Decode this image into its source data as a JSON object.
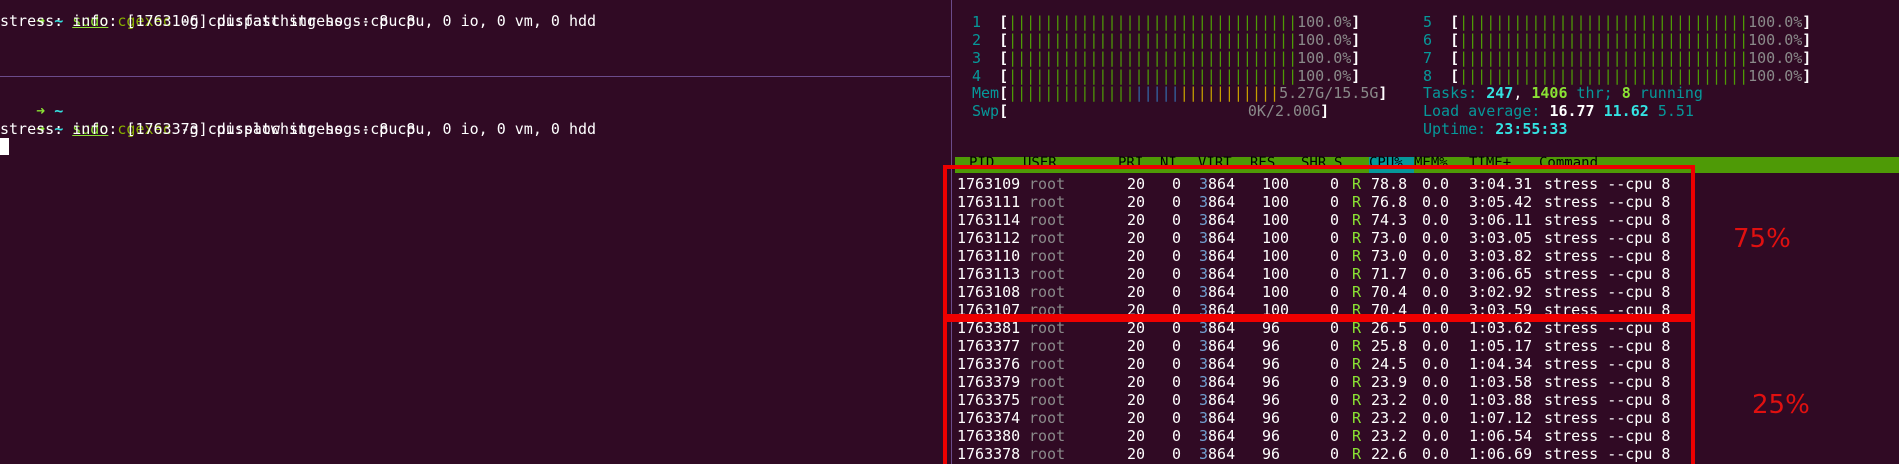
{
  "terminal_left_top": {
    "prompt_arrow": "➜",
    "prompt_tilde": "~",
    "cmd_sudo": "sudo",
    "cmd_cgexec": "cgexec",
    "cmd_rest": "-g cpu:fast stress --cpu 8",
    "output": "stress: info: [1763106] dispatching hogs: 8 cpu, 0 io, 0 vm, 0 hdd"
  },
  "terminal_left_bottom": {
    "prompt1_arrow": "➜",
    "prompt1_tilde": "~",
    "prompt2_arrow": "➜",
    "prompt2_tilde": "~",
    "cmd_sudo": "sudo",
    "cmd_cgexec": "cgexec",
    "cmd_rest": "-g cpu:slow stress --cpu 8",
    "output": "stress: info: [1763373] dispatching hogs: 8 cpu, 0 io, 0 vm, 0 hdd"
  },
  "htop": {
    "cpus": [
      {
        "id": "1",
        "bar": "||||||||||||||||||||||||||||||||",
        "pct": "100.0%"
      },
      {
        "id": "2",
        "bar": "||||||||||||||||||||||||||||||||",
        "pct": "100.0%"
      },
      {
        "id": "3",
        "bar": "||||||||||||||||||||||||||||||||",
        "pct": "100.0%"
      },
      {
        "id": "4",
        "bar": "||||||||||||||||||||||||||||||||",
        "pct": "100.0%"
      },
      {
        "id": "5",
        "bar": "||||||||||||||||||||||||||||||||",
        "pct": "100.0%"
      },
      {
        "id": "6",
        "bar": "||||||||||||||||||||||||||||||||",
        "pct": "100.0%"
      },
      {
        "id": "7",
        "bar": "||||||||||||||||||||||||||||||||",
        "pct": "100.0%"
      },
      {
        "id": "8",
        "bar": "||||||||||||||||||||||||||||||||",
        "pct": "100.0%"
      }
    ],
    "mem_label": "Mem",
    "mem_bar_green": "||||||||||||||",
    "mem_bar_blue": "|||||",
    "mem_bar_yellow": "|||||||||||",
    "mem_value": "5.27G/15.5G",
    "swp_label": "Swp",
    "swp_value": "0K/2.00G",
    "tasks_label": "Tasks:",
    "tasks_count": "247",
    "tasks_thr": "1406",
    "tasks_thr_label": "thr;",
    "tasks_running": "8",
    "tasks_running_label": "running",
    "load_label": "Load average:",
    "load_1": "16.77",
    "load_5": "11.62",
    "load_15": "5.51",
    "uptime_label": "Uptime:",
    "uptime_value": "23:55:33",
    "columns": [
      "PID",
      "USER",
      "PRI",
      "NI",
      "VIRT",
      "RES",
      "SHR",
      "S",
      "CPU%",
      "MEM%",
      "TIME+",
      "Command"
    ],
    "processes": [
      {
        "pid": "1763109",
        "user": "root",
        "pri": "20",
        "ni": "0",
        "virt": "3864",
        "res": "100",
        "shr": "0",
        "s": "R",
        "cpu": "78.8",
        "mem": "0.0",
        "time": "3:04.31",
        "cmd": "stress --cpu 8"
      },
      {
        "pid": "1763111",
        "user": "root",
        "pri": "20",
        "ni": "0",
        "virt": "3864",
        "res": "100",
        "shr": "0",
        "s": "R",
        "cpu": "76.8",
        "mem": "0.0",
        "time": "3:05.42",
        "cmd": "stress --cpu 8"
      },
      {
        "pid": "1763114",
        "user": "root",
        "pri": "20",
        "ni": "0",
        "virt": "3864",
        "res": "100",
        "shr": "0",
        "s": "R",
        "cpu": "74.3",
        "mem": "0.0",
        "time": "3:06.11",
        "cmd": "stress --cpu 8"
      },
      {
        "pid": "1763112",
        "user": "root",
        "pri": "20",
        "ni": "0",
        "virt": "3864",
        "res": "100",
        "shr": "0",
        "s": "R",
        "cpu": "73.0",
        "mem": "0.0",
        "time": "3:03.05",
        "cmd": "stress --cpu 8"
      },
      {
        "pid": "1763110",
        "user": "root",
        "pri": "20",
        "ni": "0",
        "virt": "3864",
        "res": "100",
        "shr": "0",
        "s": "R",
        "cpu": "73.0",
        "mem": "0.0",
        "time": "3:03.82",
        "cmd": "stress --cpu 8"
      },
      {
        "pid": "1763113",
        "user": "root",
        "pri": "20",
        "ni": "0",
        "virt": "3864",
        "res": "100",
        "shr": "0",
        "s": "R",
        "cpu": "71.7",
        "mem": "0.0",
        "time": "3:06.65",
        "cmd": "stress --cpu 8"
      },
      {
        "pid": "1763108",
        "user": "root",
        "pri": "20",
        "ni": "0",
        "virt": "3864",
        "res": "100",
        "shr": "0",
        "s": "R",
        "cpu": "70.4",
        "mem": "0.0",
        "time": "3:02.92",
        "cmd": "stress --cpu 8"
      },
      {
        "pid": "1763107",
        "user": "root",
        "pri": "20",
        "ni": "0",
        "virt": "3864",
        "res": "100",
        "shr": "0",
        "s": "R",
        "cpu": "70.4",
        "mem": "0.0",
        "time": "3:03.59",
        "cmd": "stress --cpu 8"
      },
      {
        "pid": "1763381",
        "user": "root",
        "pri": "20",
        "ni": "0",
        "virt": "3864",
        "res": "96",
        "shr": "0",
        "s": "R",
        "cpu": "26.5",
        "mem": "0.0",
        "time": "1:03.62",
        "cmd": "stress --cpu 8"
      },
      {
        "pid": "1763377",
        "user": "root",
        "pri": "20",
        "ni": "0",
        "virt": "3864",
        "res": "96",
        "shr": "0",
        "s": "R",
        "cpu": "25.8",
        "mem": "0.0",
        "time": "1:05.17",
        "cmd": "stress --cpu 8"
      },
      {
        "pid": "1763376",
        "user": "root",
        "pri": "20",
        "ni": "0",
        "virt": "3864",
        "res": "96",
        "shr": "0",
        "s": "R",
        "cpu": "24.5",
        "mem": "0.0",
        "time": "1:04.34",
        "cmd": "stress --cpu 8"
      },
      {
        "pid": "1763379",
        "user": "root",
        "pri": "20",
        "ni": "0",
        "virt": "3864",
        "res": "96",
        "shr": "0",
        "s": "R",
        "cpu": "23.9",
        "mem": "0.0",
        "time": "1:03.58",
        "cmd": "stress --cpu 8"
      },
      {
        "pid": "1763375",
        "user": "root",
        "pri": "20",
        "ni": "0",
        "virt": "3864",
        "res": "96",
        "shr": "0",
        "s": "R",
        "cpu": "23.2",
        "mem": "0.0",
        "time": "1:03.88",
        "cmd": "stress --cpu 8"
      },
      {
        "pid": "1763374",
        "user": "root",
        "pri": "20",
        "ni": "0",
        "virt": "3864",
        "res": "96",
        "shr": "0",
        "s": "R",
        "cpu": "23.2",
        "mem": "0.0",
        "time": "1:07.12",
        "cmd": "stress --cpu 8"
      },
      {
        "pid": "1763380",
        "user": "root",
        "pri": "20",
        "ni": "0",
        "virt": "3864",
        "res": "96",
        "shr": "0",
        "s": "R",
        "cpu": "23.2",
        "mem": "0.0",
        "time": "1:06.54",
        "cmd": "stress --cpu 8"
      },
      {
        "pid": "1763378",
        "user": "root",
        "pri": "20",
        "ni": "0",
        "virt": "3864",
        "res": "96",
        "shr": "0",
        "s": "R",
        "cpu": "22.6",
        "mem": "0.0",
        "time": "1:06.69",
        "cmd": "stress --cpu 8"
      }
    ]
  },
  "annotations": {
    "fast_label": "75%",
    "slow_label": "25%",
    "color": "#ee0000"
  },
  "colors": {
    "background": "#300a24",
    "prompt_green": "#8ae234",
    "htop_header": "#4e9a06",
    "sort_column": "#06989a"
  }
}
